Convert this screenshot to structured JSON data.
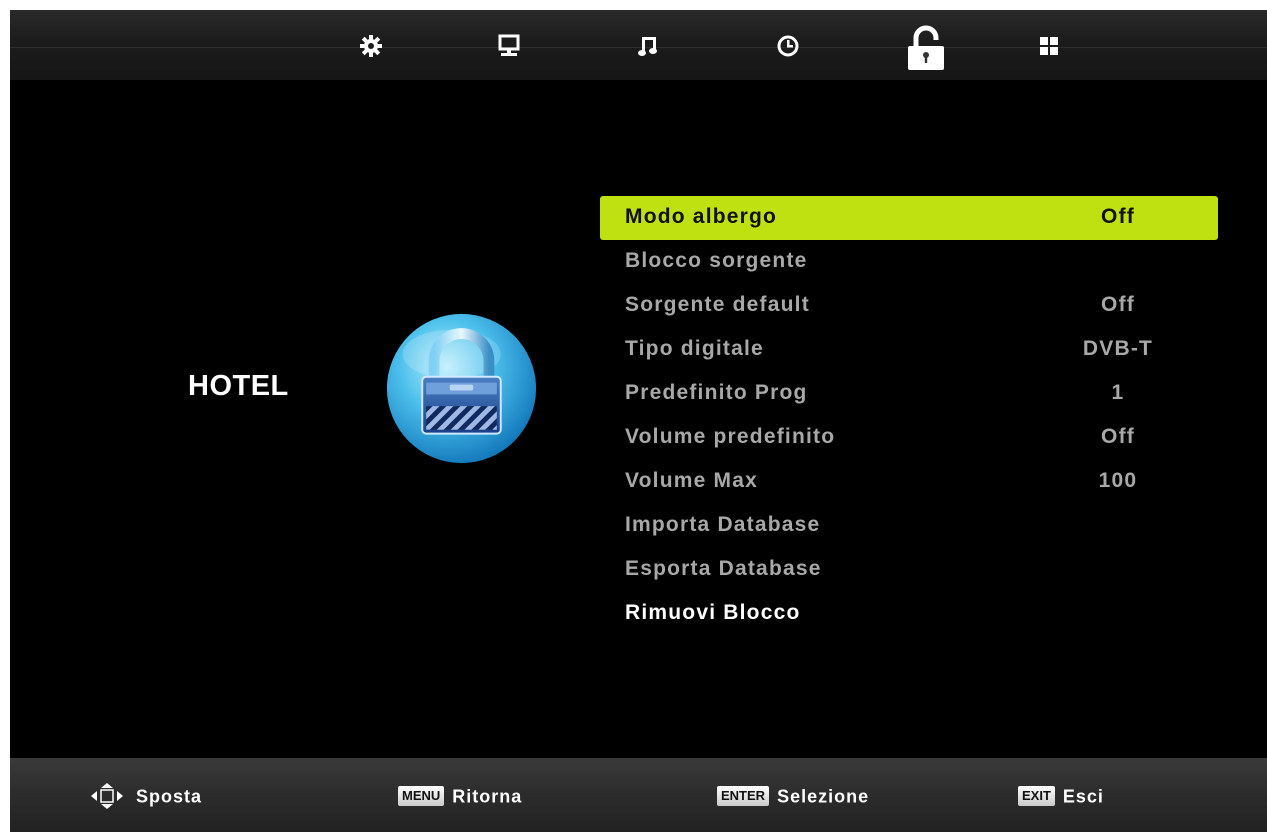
{
  "top_tabs": [
    {
      "name": "settings-gear",
      "icon": "gear-icon"
    },
    {
      "name": "picture",
      "icon": "monitor-icon"
    },
    {
      "name": "sound",
      "icon": "music-note-icon"
    },
    {
      "name": "time",
      "icon": "clock-icon"
    },
    {
      "name": "lock",
      "icon": "lock-icon",
      "active": true
    },
    {
      "name": "apps",
      "icon": "grid-icon"
    }
  ],
  "section": {
    "title": "HOTEL",
    "icon": "padlock-icon"
  },
  "menu": {
    "items": [
      {
        "label": "Modo albergo",
        "value": "Off"
      },
      {
        "label": "Blocco sorgente",
        "value": ""
      },
      {
        "label": "Sorgente default",
        "value": "Off"
      },
      {
        "label": "Tipo digitale",
        "value": "DVB-T"
      },
      {
        "label": "Predefinito Prog",
        "value": "1"
      },
      {
        "label": "Volume predefinito",
        "value": "Off"
      },
      {
        "label": "Volume Max",
        "value": "100"
      },
      {
        "label": "Importa Database",
        "value": ""
      },
      {
        "label": "Esporta Database",
        "value": ""
      },
      {
        "label": "Rimuovi Blocco",
        "value": ""
      }
    ],
    "selected_index": 0
  },
  "hints": {
    "move": {
      "icon": "dpad-icon",
      "text": "Sposta"
    },
    "back": {
      "key": "MENU",
      "text": "Ritorna"
    },
    "select": {
      "key": "ENTER",
      "text": "Selezione"
    },
    "exit": {
      "key": "EXIT",
      "text": "Esci"
    }
  },
  "colors": {
    "highlight": "#bfe011",
    "background": "#000000",
    "inactive_text": "#a8a8a8"
  }
}
